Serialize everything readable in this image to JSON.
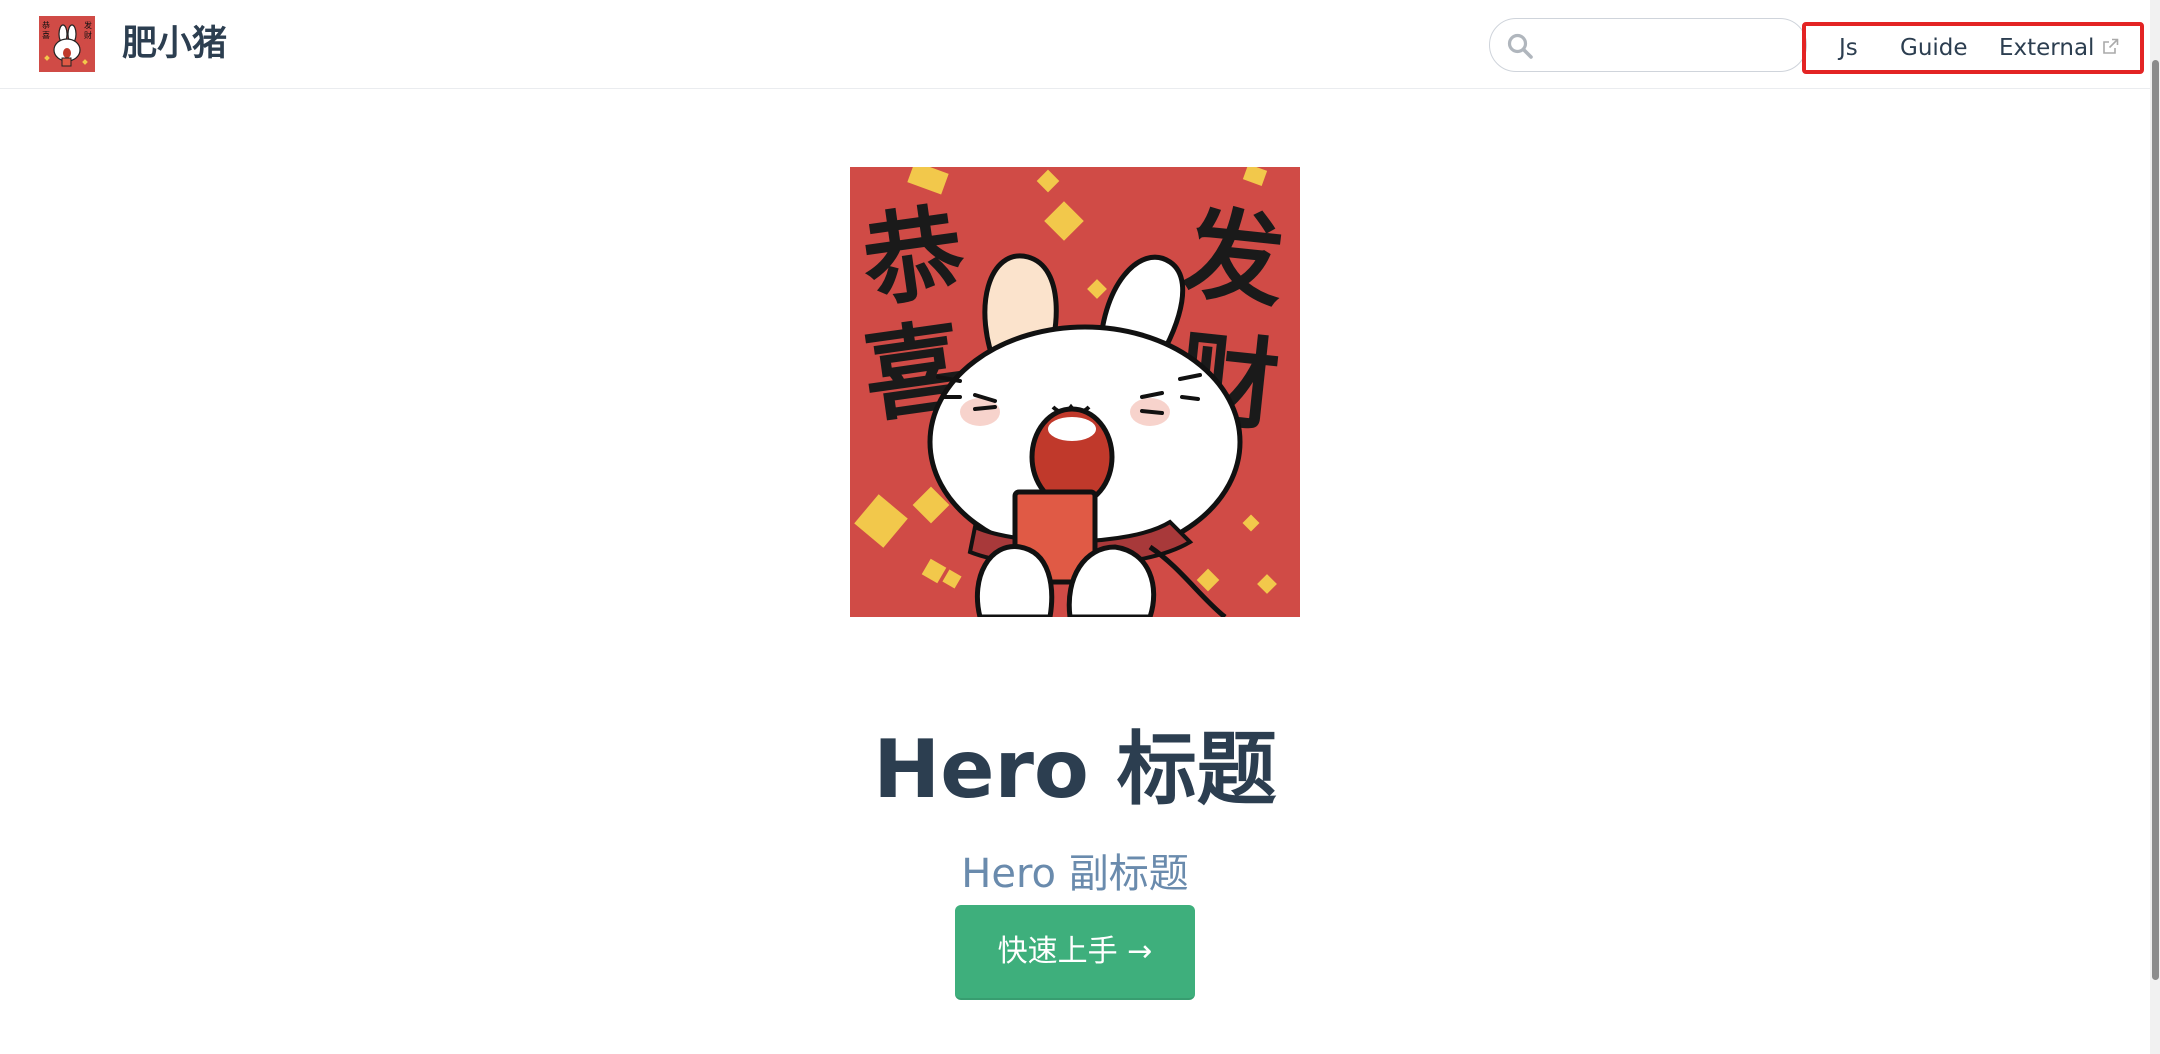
{
  "header": {
    "site_name": "肥小猪",
    "logo_icon": "rabbit-red-envelope-logo",
    "search": {
      "placeholder": "",
      "value": "",
      "icon": "search-icon"
    },
    "nav": [
      {
        "label": "Js"
      },
      {
        "label": "Guide"
      },
      {
        "label": "External",
        "icon": "external-link-icon"
      }
    ]
  },
  "hero": {
    "image": {
      "icon": "rabbit-holding-red-envelope",
      "left_text": "恭喜",
      "right_text": "发财"
    },
    "title": "Hero 标题",
    "subtitle": "Hero 副标题",
    "action_label": "快速上手 →"
  },
  "colors": {
    "accent": "#3eaf7c",
    "text": "#2c3e50",
    "subtitle": "#6a8bad",
    "highlight_box": "#e32424",
    "image_background": "#d04b46"
  }
}
